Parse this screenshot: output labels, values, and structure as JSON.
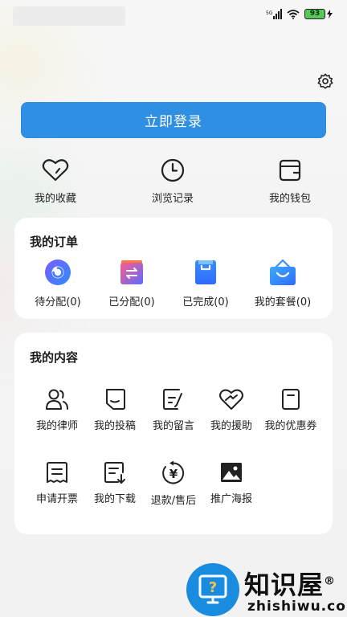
{
  "status_bar": {
    "signal": "5G",
    "battery": "93"
  },
  "login_button": "立即登录",
  "quick_links": [
    {
      "label": "我的收藏",
      "icon": "heart-icon"
    },
    {
      "label": "浏览记录",
      "icon": "clock-icon"
    },
    {
      "label": "我的钱包",
      "icon": "wallet-icon"
    }
  ],
  "orders": {
    "title": "我的订单",
    "items": [
      {
        "label": "待分配(0)",
        "icon": "pending-assign-icon"
      },
      {
        "label": "已分配(0)",
        "icon": "assigned-icon"
      },
      {
        "label": "已完成(0)",
        "icon": "completed-icon"
      },
      {
        "label": "我的套餐(0)",
        "icon": "package-icon"
      }
    ]
  },
  "content": {
    "title": "我的内容",
    "items": [
      {
        "label": "我的律师",
        "icon": "lawyer-icon"
      },
      {
        "label": "我的投稿",
        "icon": "submission-icon"
      },
      {
        "label": "我的留言",
        "icon": "message-icon"
      },
      {
        "label": "我的援助",
        "icon": "aid-icon"
      },
      {
        "label": "我的优惠券",
        "icon": "coupon-icon"
      },
      {
        "label": "申请开票",
        "icon": "invoice-icon"
      },
      {
        "label": "我的下载",
        "icon": "download-icon"
      },
      {
        "label": "退款/售后",
        "icon": "refund-icon"
      },
      {
        "label": "推广海报",
        "icon": "poster-icon"
      }
    ]
  },
  "watermark": {
    "text": "知识屋",
    "registered": "®",
    "sub": "zhishiwu.com"
  },
  "colors": {
    "accent": "#2f8fe3",
    "card": "#ffffff",
    "background": "#f4f4f4"
  }
}
